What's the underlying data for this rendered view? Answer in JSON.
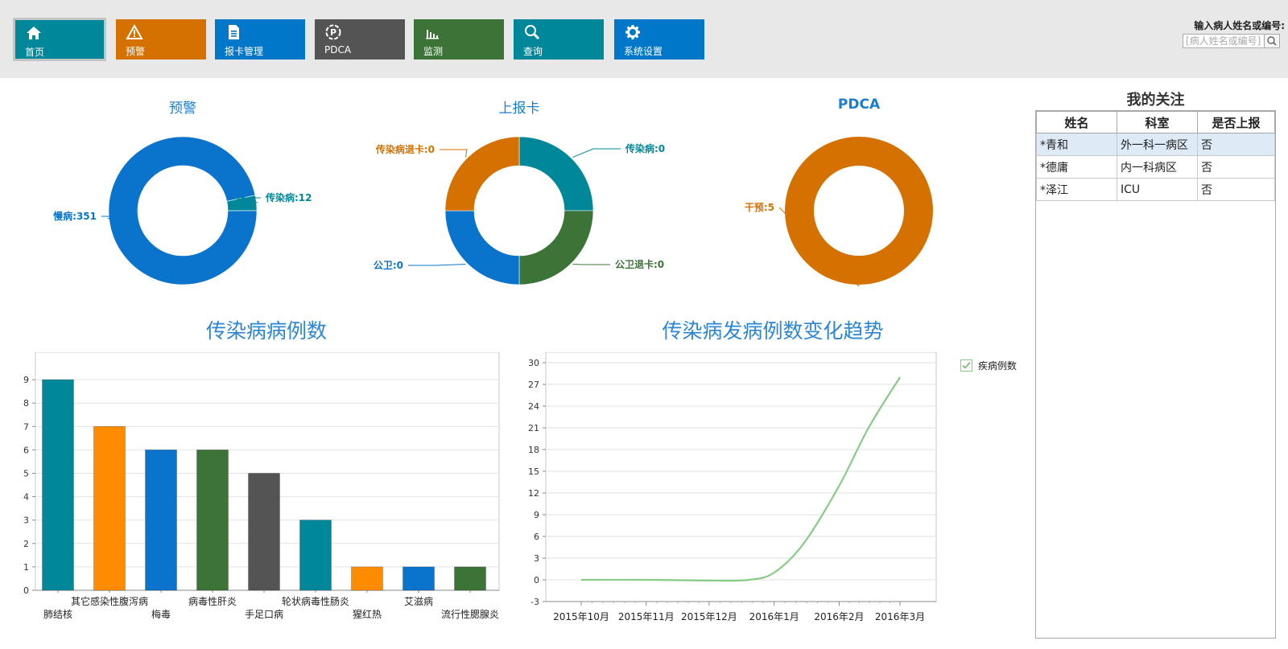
{
  "nav": {
    "items": [
      {
        "label": "首页",
        "icon": "home-icon",
        "color": "#00879a",
        "active": true
      },
      {
        "label": "预警",
        "icon": "warning-icon",
        "color": "#d47100"
      },
      {
        "label": "报卡管理",
        "icon": "document-icon",
        "color": "#0077c8"
      },
      {
        "label": "PDCA",
        "icon": "pdca-icon",
        "color": "#545454"
      },
      {
        "label": "监测",
        "icon": "bar-chart-icon",
        "color": "#3c7437"
      },
      {
        "label": "查询",
        "icon": "search-icon",
        "color": "#00879a"
      },
      {
        "label": "系统设置",
        "icon": "gear-icon",
        "color": "#0077c8"
      }
    ]
  },
  "search": {
    "title": "输入病人姓名或编号:",
    "placeholder": "[病人姓名或编号]",
    "button_icon": "search-icon"
  },
  "donuts": [
    {
      "title": "预警",
      "title_bold": false,
      "slices": [
        {
          "label": "慢病",
          "value": 351,
          "color": "#0a74cd"
        },
        {
          "label": "传染病",
          "value": 12,
          "color": "#00879a"
        }
      ]
    },
    {
      "title": "上报卡",
      "title_bold": false,
      "slices": [
        {
          "label": "传染病",
          "value": 0,
          "color": "#00879a"
        },
        {
          "label": "公卫退卡",
          "value": 0,
          "color": "#3c7437"
        },
        {
          "label": "公卫",
          "value": 0,
          "color": "#0a74cd"
        },
        {
          "label": "传染病退卡",
          "value": 0,
          "color": "#d47100"
        }
      ]
    },
    {
      "title": "PDCA",
      "title_bold": true,
      "slices": [
        {
          "label": "干预",
          "value": 5,
          "color": "#d47100"
        }
      ]
    }
  ],
  "bar_chart": {
    "title": "传染病病例数"
  },
  "line_chart": {
    "title": "传染病发病例数变化趋势",
    "legend_label": "疾病例数"
  },
  "chart_data": [
    {
      "type": "bar",
      "title": "传染病病例数",
      "categories": [
        "肺结核",
        "其它感染性腹泻病",
        "梅毒",
        "病毒性肝炎",
        "手足口病",
        "轮状病毒性肠炎",
        "猩红热",
        "艾滋病",
        "流行性腮腺炎"
      ],
      "values": [
        9,
        7,
        6,
        6,
        5,
        3,
        1,
        1,
        1
      ],
      "colors": [
        "#00879a",
        "#ff8c00",
        "#0a74cd",
        "#3c7437",
        "#545454",
        "#00879a",
        "#ff8c00",
        "#0a74cd",
        "#3c7437"
      ],
      "ylim": [
        0,
        10
      ],
      "yticks": [
        0,
        1,
        2,
        3,
        4,
        5,
        6,
        7,
        8,
        9
      ],
      "grid": true
    },
    {
      "type": "line",
      "title": "传染病发病例数变化趋势",
      "x": [
        "2015-10-01",
        "2015-11-01",
        "2015-12-01",
        "2015-12-20",
        "2016-01-01",
        "2016-01-15",
        "2016-02-01",
        "2016-02-15",
        "2016-03-01"
      ],
      "xticks": [
        "2015年10月",
        "2015年11月",
        "2015年12月",
        "2016年1月",
        "2016年2月",
        "2016年3月"
      ],
      "series": [
        {
          "name": "疾病例数",
          "values": [
            0,
            0,
            -0.1,
            0,
            1,
            5,
            13,
            21,
            28
          ],
          "color": "#86cc86"
        }
      ],
      "ylim": [
        -3,
        31
      ],
      "yticks": [
        -3,
        0,
        3,
        6,
        9,
        12,
        15,
        18,
        21,
        24,
        27,
        30
      ],
      "legend": "top-right",
      "grid": true
    }
  ],
  "watch_panel": {
    "title": "我的关注",
    "columns": [
      "姓名",
      "科室",
      "是否上报"
    ],
    "rows": [
      {
        "name": "*青和",
        "dept": "外一科一病区",
        "reported": "否",
        "selected": true
      },
      {
        "name": "*德庸",
        "dept": "内一科病区",
        "reported": "否"
      },
      {
        "name": "*泽江",
        "dept": "ICU",
        "reported": "否"
      }
    ]
  }
}
